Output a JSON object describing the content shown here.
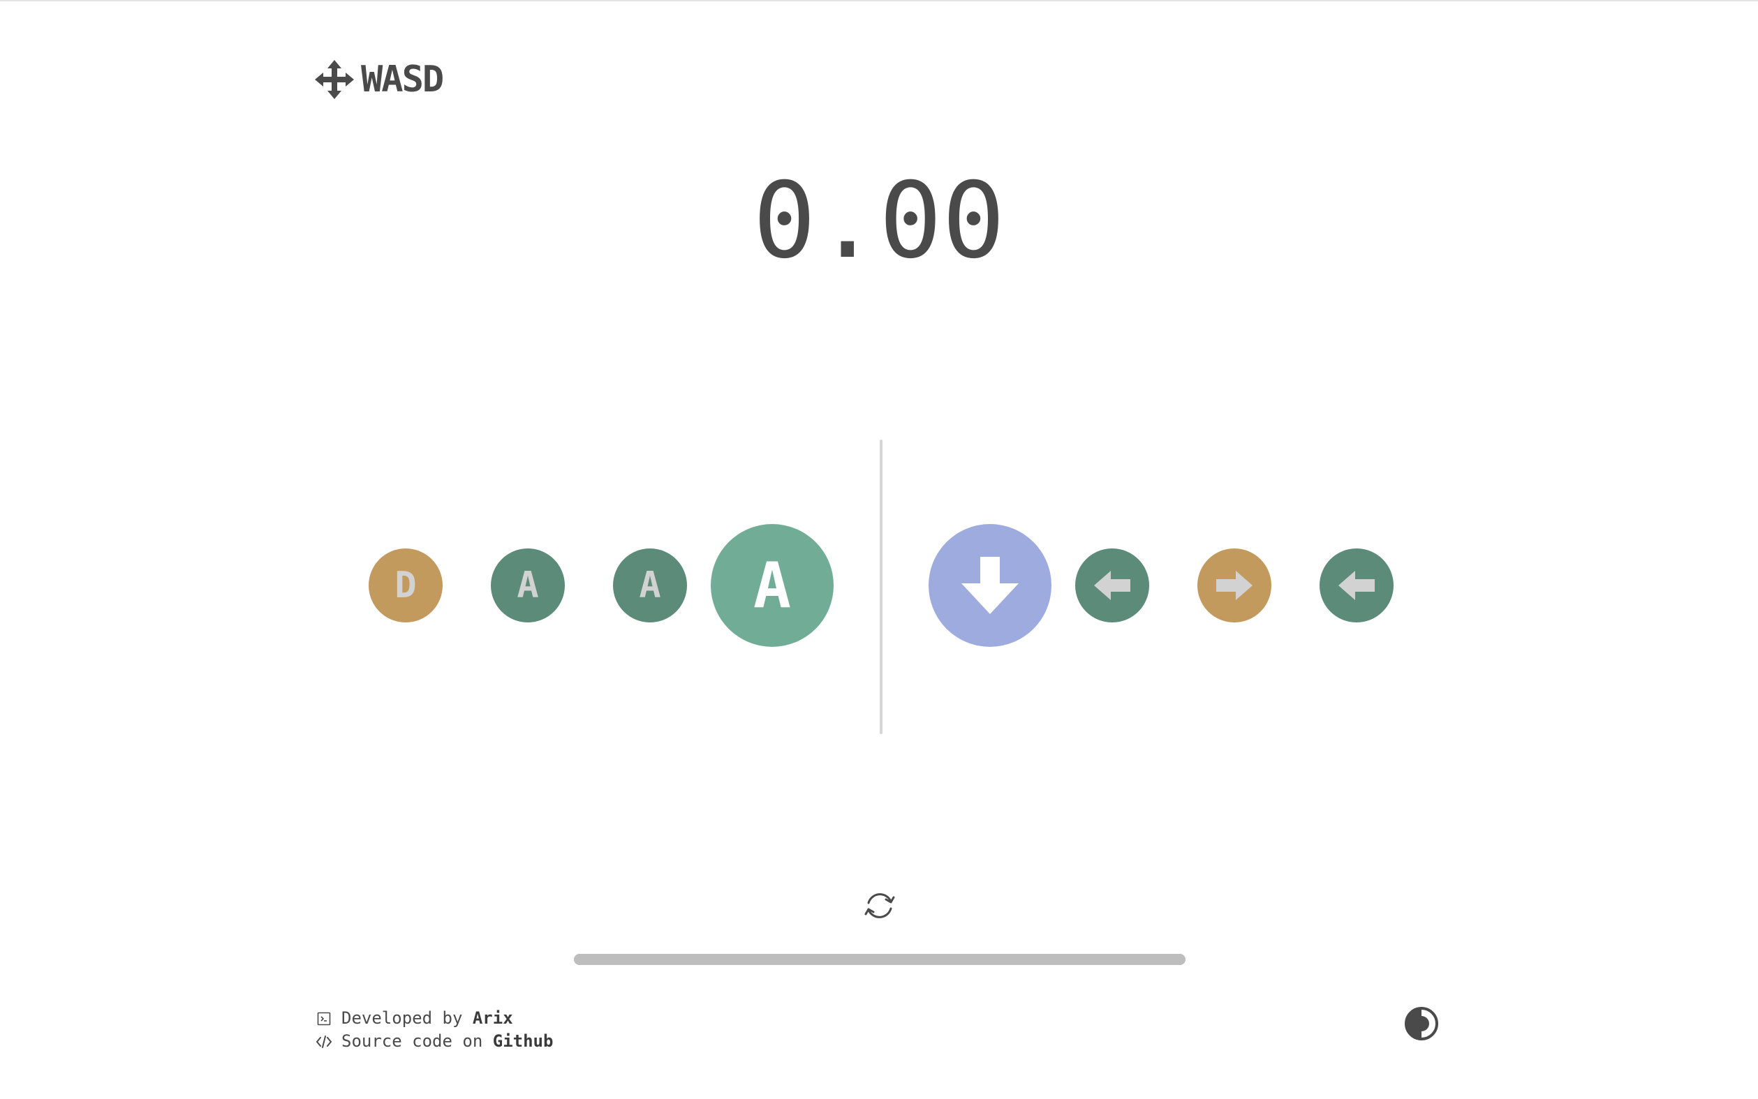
{
  "app": {
    "logo_text": "WASD",
    "logo_icon": "move-arrows-icon"
  },
  "timer": {
    "value": "0.00"
  },
  "key_history": [
    {
      "label": "D",
      "color": "#c39a5e"
    },
    {
      "label": "A",
      "color": "#5c8b7a"
    },
    {
      "label": "A",
      "color": "#5c8b7a"
    }
  ],
  "current_key": {
    "label": "A",
    "color": "#71ad96"
  },
  "next_key": {
    "icon": "arrow-down-icon",
    "color": "#9dabde"
  },
  "upcoming_keys": [
    {
      "icon": "arrow-left-icon",
      "color": "#5c8b7a"
    },
    {
      "icon": "arrow-right-icon",
      "color": "#c39a5e"
    },
    {
      "icon": "arrow-left-icon",
      "color": "#5c8b7a"
    }
  ],
  "controls": {
    "reset_icon": "refresh-icon",
    "progress_percent": 100,
    "progress_color": "#bdbdbd",
    "theme_icon": "contrast-icon"
  },
  "footer": {
    "developed_prefix": "Developed by ",
    "developer_name": "Arix",
    "source_prefix": "Source code on ",
    "source_link": "Github"
  }
}
